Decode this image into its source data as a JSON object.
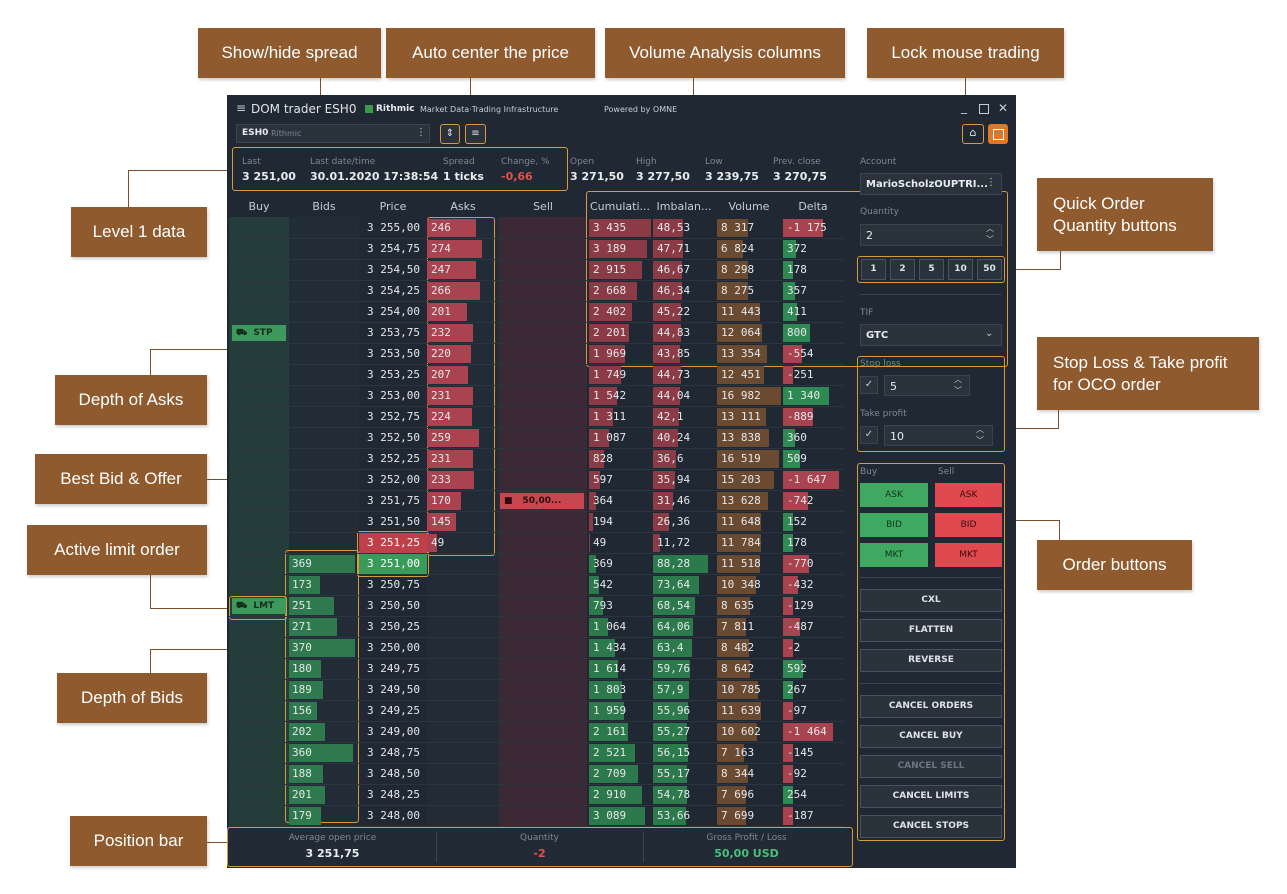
{
  "window": {
    "title": "DOM trader ESH0",
    "brand": "Rithmic",
    "brand_tagline": "Market Data·Trading Infrastructure",
    "powered_by": "Powered by OMNE"
  },
  "symbol": {
    "name": "ESH0",
    "provider": "Rithmic"
  },
  "level1": [
    {
      "label": "Last",
      "value": "3 251,00"
    },
    {
      "label": "Last date/time",
      "value": "30.01.2020 17:38:54"
    },
    {
      "label": "Spread",
      "value": "1 ticks"
    },
    {
      "label": "Change, %",
      "value": "-0,66"
    },
    {
      "label": "Open",
      "value": "3 271,50"
    },
    {
      "label": "High",
      "value": "3 277,50"
    },
    {
      "label": "Low",
      "value": "3 239,75"
    },
    {
      "label": "Prev. close",
      "value": "3 270,75"
    }
  ],
  "columns": [
    "Buy",
    "Bids",
    "Price",
    "Asks",
    "Sell",
    "Cumulati...",
    "Imbalan...",
    "Volume",
    "Delta"
  ],
  "rows": [
    {
      "price": "3 255,00",
      "ask": "246",
      "cum": "3 435",
      "imb": "48,53",
      "vol": "8 317",
      "delta": "-1 175"
    },
    {
      "price": "3 254,75",
      "ask": "274",
      "cum": "3 189",
      "imb": "47,71",
      "vol": "6 824",
      "delta": "372"
    },
    {
      "price": "3 254,50",
      "ask": "247",
      "cum": "2 915",
      "imb": "46,67",
      "vol": "8 298",
      "delta": "178"
    },
    {
      "price": "3 254,25",
      "ask": "266",
      "cum": "2 668",
      "imb": "46,34",
      "vol": "8 275",
      "delta": "357"
    },
    {
      "price": "3 254,00",
      "ask": "201",
      "cum": "2 402",
      "imb": "45,22",
      "vol": "11 443",
      "delta": "411"
    },
    {
      "price": "3 253,75",
      "ask": "232",
      "cum": "2 201",
      "imb": "44,83",
      "vol": "12 064",
      "delta": "800",
      "buy_order": "STP"
    },
    {
      "price": "3 253,50",
      "ask": "220",
      "cum": "1 969",
      "imb": "43,85",
      "vol": "13 354",
      "delta": "-554"
    },
    {
      "price": "3 253,25",
      "ask": "207",
      "cum": "1 749",
      "imb": "44,73",
      "vol": "12 451",
      "delta": "-251"
    },
    {
      "price": "3 253,00",
      "ask": "231",
      "cum": "1 542",
      "imb": "44,04",
      "vol": "16 982",
      "delta": "1 340"
    },
    {
      "price": "3 252,75",
      "ask": "224",
      "cum": "1 311",
      "imb": "42,1",
      "vol": "13 111",
      "delta": "-889"
    },
    {
      "price": "3 252,50",
      "ask": "259",
      "cum": "1 087",
      "imb": "40,24",
      "vol": "13 838",
      "delta": "360"
    },
    {
      "price": "3 252,25",
      "ask": "231",
      "cum": "828",
      "imb": "36,6",
      "vol": "16 519",
      "delta": "509"
    },
    {
      "price": "3 252,00",
      "ask": "233",
      "cum": "597",
      "imb": "35,94",
      "vol": "15 203",
      "delta": "-1 647"
    },
    {
      "price": "3 251,75",
      "ask": "170",
      "cum": "364",
      "imb": "31,46",
      "vol": "13 628",
      "delta": "-742",
      "sell_order": "50,00..."
    },
    {
      "price": "3 251,50",
      "ask": "145",
      "cum": "194",
      "imb": "26,36",
      "vol": "11 648",
      "delta": "152"
    },
    {
      "price": "3 251,25",
      "ask": "49",
      "cum": "49",
      "imb": "11,72",
      "vol": "11 784",
      "delta": "178",
      "best": "ask"
    },
    {
      "price": "3 251,00",
      "bid": "369",
      "cum": "369",
      "imb": "88,28",
      "vol": "11 518",
      "delta": "-770",
      "best": "bid"
    },
    {
      "price": "3 250,75",
      "bid": "173",
      "cum": "542",
      "imb": "73,64",
      "vol": "10 348",
      "delta": "-432"
    },
    {
      "price": "3 250,50",
      "bid": "251",
      "cum": "793",
      "imb": "68,54",
      "vol": "8 635",
      "delta": "-129",
      "buy_order": "LMT"
    },
    {
      "price": "3 250,25",
      "bid": "271",
      "cum": "1 064",
      "imb": "64,06",
      "vol": "7 811",
      "delta": "-487"
    },
    {
      "price": "3 250,00",
      "bid": "370",
      "cum": "1 434",
      "imb": "63,4",
      "vol": "8 482",
      "delta": "-2"
    },
    {
      "price": "3 249,75",
      "bid": "180",
      "cum": "1 614",
      "imb": "59,76",
      "vol": "8 642",
      "delta": "592"
    },
    {
      "price": "3 249,50",
      "bid": "189",
      "cum": "1 803",
      "imb": "57,9",
      "vol": "10 785",
      "delta": "267"
    },
    {
      "price": "3 249,25",
      "bid": "156",
      "cum": "1 959",
      "imb": "55,96",
      "vol": "11 639",
      "delta": "-97"
    },
    {
      "price": "3 249,00",
      "bid": "202",
      "cum": "2 161",
      "imb": "55,27",
      "vol": "10 602",
      "delta": "-1 464"
    },
    {
      "price": "3 248,75",
      "bid": "360",
      "cum": "2 521",
      "imb": "56,15",
      "vol": "7 163",
      "delta": "-145"
    },
    {
      "price": "3 248,50",
      "bid": "188",
      "cum": "2 709",
      "imb": "55,17",
      "vol": "8 344",
      "delta": "-92"
    },
    {
      "price": "3 248,25",
      "bid": "201",
      "cum": "2 910",
      "imb": "54,78",
      "vol": "7 696",
      "delta": "254"
    },
    {
      "price": "3 248,00",
      "bid": "179",
      "cum": "3 089",
      "imb": "53,66",
      "vol": "7 699",
      "delta": "-187"
    }
  ],
  "position": [
    {
      "label": "Average open price",
      "value": "3 251,75"
    },
    {
      "label": "Quantity",
      "value": "-2"
    },
    {
      "label": "Gross Profit / Loss",
      "value": "50,00 USD"
    }
  ],
  "panel": {
    "account_label": "Account",
    "account": "MarioScholzOUPTRI...",
    "quantity_label": "Quantity",
    "quantity": "2",
    "quick_qty": [
      "1",
      "2",
      "5",
      "10",
      "50"
    ],
    "tif_label": "TIF",
    "tif": "GTC",
    "sl_label": "Stop loss",
    "sl": "5",
    "tp_label": "Take profit",
    "tp": "10",
    "buy_label": "Buy",
    "sell_label": "Sell",
    "order_buttons": [
      [
        "ASK",
        "ASK"
      ],
      [
        "BID",
        "BID"
      ],
      [
        "MKT",
        "MKT"
      ]
    ],
    "actions": [
      "CXL",
      "FLATTEN",
      "REVERSE"
    ],
    "cancels": [
      "CANCEL ORDERS",
      "CANCEL BUY",
      "CANCEL SELL",
      "CANCEL LIMITS",
      "CANCEL STOPS"
    ]
  },
  "callouts": {
    "spread": "Show/hide spread",
    "autocenter": "Auto center the price",
    "volume": "Volume Analysis columns",
    "lock": "Lock mouse trading",
    "level1": "Level 1 data",
    "quickqty": "Quick Order Quantity buttons",
    "depthasks": "Depth of Asks",
    "bbo": "Best Bid & Offer",
    "activelimit": "Active limit order",
    "depthbids": "Depth of Bids",
    "sltp": "Stop Loss & Take profit for OCO order",
    "orderbtns": "Order buttons",
    "posbar": "Position bar"
  },
  "colors": {
    "bg": "#1f2833",
    "ask": "#a8434f",
    "bid": "#2e7a4e",
    "accent": "#d99a3c",
    "callout": "#8e5a2e",
    "negative": "#e0524b",
    "positive": "#44c27a"
  }
}
